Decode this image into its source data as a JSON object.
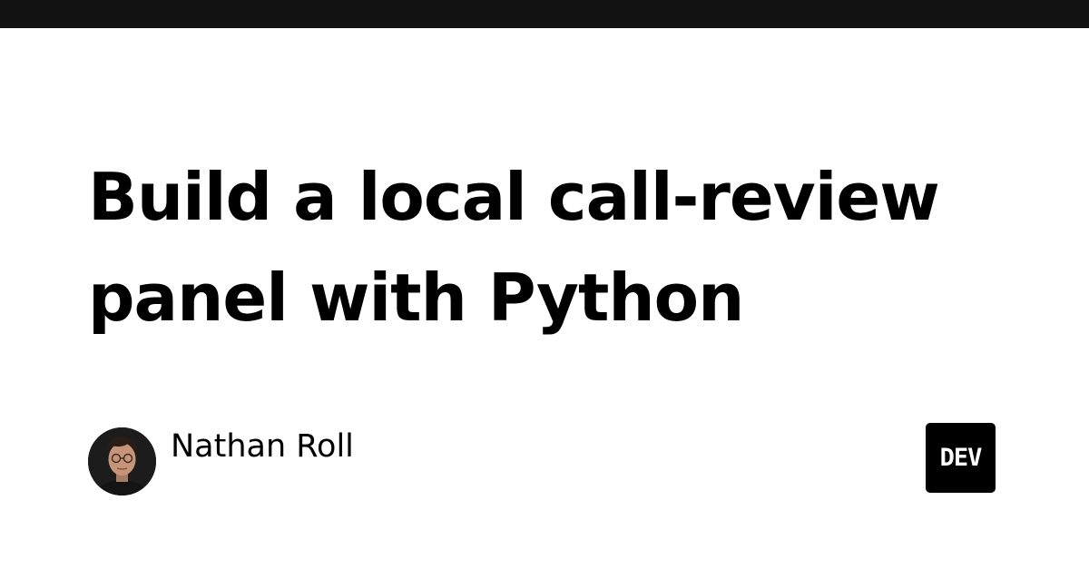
{
  "title": "Build a local call-review panel with Python",
  "author": {
    "name": "Nathan Roll"
  },
  "logo": {
    "text": "DEV"
  },
  "colors": {
    "top_bar": "#121212",
    "background": "#ffffff",
    "text": "#000000",
    "logo_bg": "#000000"
  }
}
